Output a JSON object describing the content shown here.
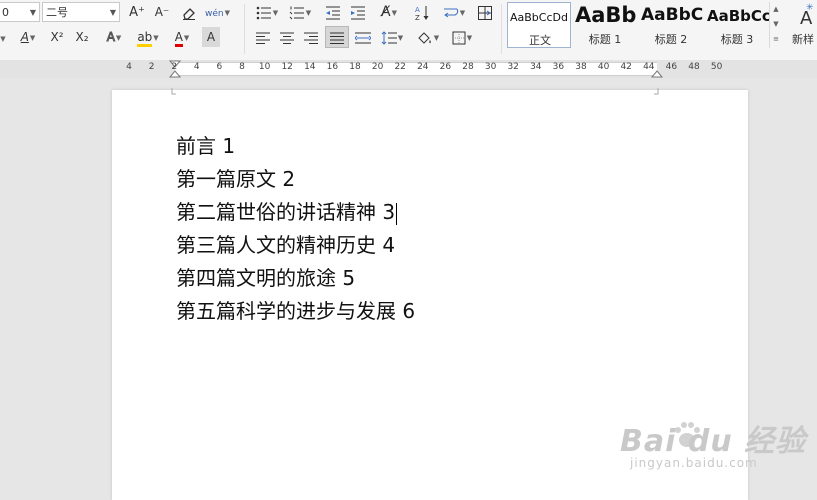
{
  "toolbar": {
    "font_name_partial": "0",
    "font_size": "二号",
    "grow_font": "A⁺",
    "shrink_font": "A⁻",
    "phonetic_guide": "wén",
    "superscript": "X²",
    "subscript": "X₂",
    "text_effect": "A",
    "highlight": "ab",
    "font_color": "A",
    "char_shading": "A"
  },
  "styles": [
    {
      "preview": "AaBbCcDd",
      "label": "正文",
      "selected": true
    },
    {
      "preview": "AaBb",
      "label": "标题 1"
    },
    {
      "preview": "AaBbC",
      "label": "标题 2"
    },
    {
      "preview": "AaBbCc",
      "label": "标题 3"
    }
  ],
  "new_style": {
    "label": "新样"
  },
  "ruler": {
    "numbers": [
      "4",
      "2",
      "2",
      "4",
      "6",
      "8",
      "10",
      "12",
      "14",
      "16",
      "18",
      "20",
      "22",
      "24",
      "26",
      "28",
      "30",
      "32",
      "34",
      "36",
      "38",
      "40",
      "42",
      "44",
      "46",
      "48",
      "50"
    ]
  },
  "document": {
    "lines": [
      "前言 1",
      "第一篇原文 2",
      "第二篇世俗的讲话精神 3",
      "第三篇人文的精神历史 4",
      "第四篇文明的旅途 5",
      "第五篇科学的进步与发展 6"
    ]
  },
  "watermark": {
    "main": "Bai du 经验",
    "sub": "jingyan.baidu.com"
  }
}
